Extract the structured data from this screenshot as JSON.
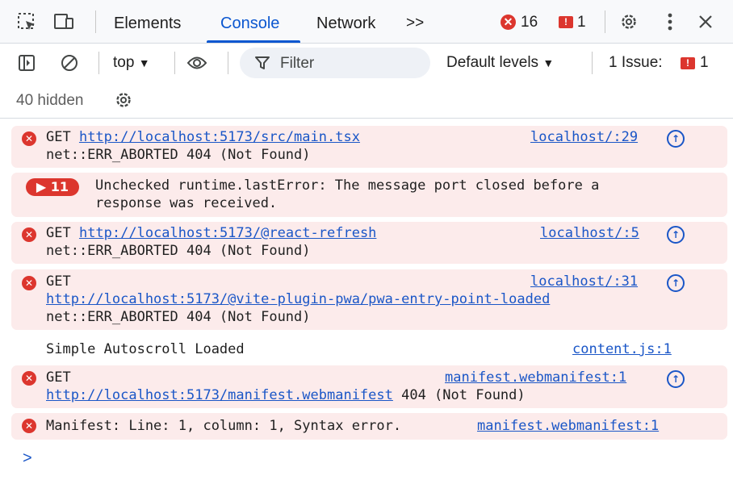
{
  "tabs": {
    "elements": "Elements",
    "console": "Console",
    "network": "Network",
    "more": ">>",
    "error_count": "16",
    "issue_count": "1"
  },
  "toolbar": {
    "context": "top",
    "filter_placeholder": "Filter",
    "levels": "Default levels",
    "issues_label": "1 Issue:",
    "issues_count": "1"
  },
  "hidden": {
    "label": "40 hidden"
  },
  "messages": [
    {
      "level": "error",
      "lines": [
        "GET ",
        "http://localhost:5173/src/main.tsx",
        "net::ERR_ABORTED 404 (Not Found)"
      ],
      "source": "localhost/:29"
    },
    {
      "level": "error",
      "repeat": "11",
      "lines": [
        "Unchecked runtime.lastError: The message port closed before a",
        "response was received."
      ]
    },
    {
      "level": "error",
      "lines": [
        "GET ",
        "http://localhost:5173/@react-refresh",
        "net::ERR_ABORTED 404 (Not Found)"
      ],
      "source": "localhost/:5"
    },
    {
      "level": "error",
      "lines": [
        "GET",
        "http://localhost:5173/@vite-plugin-pwa/pwa-entry-point-loaded",
        "net::ERR_ABORTED 404 (Not Found)"
      ],
      "source": "localhost/:31"
    },
    {
      "level": "info",
      "lines": [
        "Simple Autoscroll Loaded"
      ],
      "source": "content.js:1"
    },
    {
      "level": "error",
      "lines": [
        "GET",
        "http://localhost:5173/manifest.webmanifest",
        " 404 (Not Found)"
      ],
      "source": "manifest.webmanifest:1"
    },
    {
      "level": "error",
      "lines": [
        "Manifest: Line: 1, column: 1, Syntax error."
      ],
      "source": "manifest.webmanifest:1"
    }
  ],
  "prompt": ">",
  "icons": {
    "inspect": "inspect-element-icon",
    "device": "device-toolbar-icon",
    "settings": "gear-icon",
    "menu": "kebab-menu-icon",
    "close": "close-icon",
    "sidebar": "sidebar-toggle-icon",
    "clear": "clear-console-icon",
    "eye": "live-expression-icon",
    "filter": "filter-icon",
    "source_nav": "network-request-icon"
  },
  "colors": {
    "accent": "#0b57d0",
    "error": "#dc362e",
    "error_bg": "#fcebeb",
    "link": "#1a56c7"
  }
}
